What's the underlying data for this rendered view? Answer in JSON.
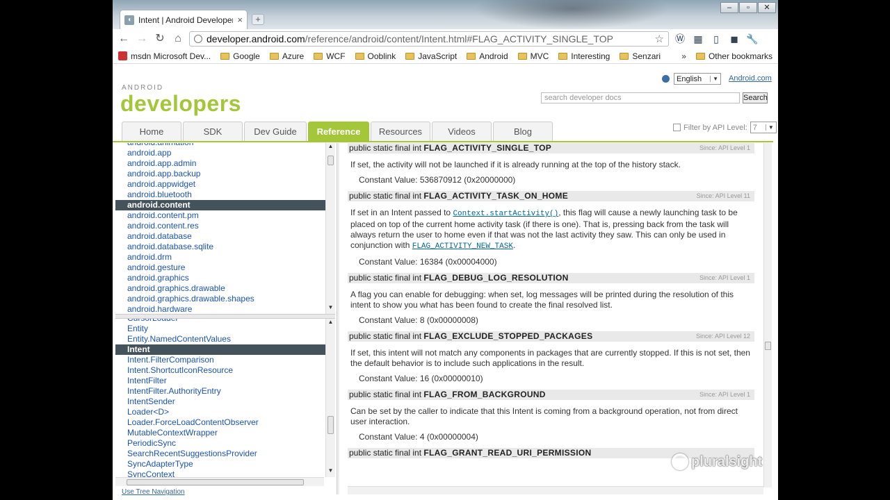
{
  "browser": {
    "tab_title": "Intent | Android Developers",
    "url_host": "developer.android.com",
    "url_path": "/reference/android/content/Intent.html#FLAG_ACTIVITY_SINGLE_TOP",
    "bookmarks": [
      {
        "label": "msdn Microsoft Dev...",
        "icon": "msdn-icon"
      },
      {
        "label": "Google",
        "icon": "folder-icon"
      },
      {
        "label": "Azure",
        "icon": "folder-icon"
      },
      {
        "label": "WCF",
        "icon": "folder-icon"
      },
      {
        "label": "Ooblink",
        "icon": "folder-icon"
      },
      {
        "label": "JavaScript",
        "icon": "folder-icon"
      },
      {
        "label": "Android",
        "icon": "folder-icon"
      },
      {
        "label": "MVC",
        "icon": "folder-icon"
      },
      {
        "label": "Interesting",
        "icon": "folder-icon"
      },
      {
        "label": "Senzari",
        "icon": "folder-icon"
      }
    ],
    "more_bookmarks": "»",
    "other_bookmarks": "Other bookmarks"
  },
  "site": {
    "logo_small": "ANDROID",
    "logo": "developers",
    "language": "English",
    "android_com": "Android.com",
    "search_placeholder": "search developer docs",
    "search_button": "Search",
    "tabs": [
      "Home",
      "SDK",
      "Dev Guide",
      "Reference",
      "Resources",
      "Videos",
      "Blog"
    ],
    "active_tab": "Reference",
    "filter_label": "Filter by API Level:",
    "filter_value": "7",
    "tree_nav": "Use Tree Navigation",
    "brand_color": "#a4c639"
  },
  "packages": [
    "android.animation",
    "android.app",
    "android.app.admin",
    "android.app.backup",
    "android.appwidget",
    "android.bluetooth",
    "android.content",
    "android.content.pm",
    "android.content.res",
    "android.database",
    "android.database.sqlite",
    "android.drm",
    "android.gesture",
    "android.graphics",
    "android.graphics.drawable",
    "android.graphics.drawable.shapes",
    "android.hardware"
  ],
  "selected_package": "android.content",
  "classes": [
    "CursorLoader",
    "Entity",
    "Entity.NamedContentValues",
    "Intent",
    "Intent.FilterComparison",
    "Intent.ShortcutIconResource",
    "IntentFilter",
    "IntentFilter.AuthorityEntry",
    "IntentSender",
    "Loader<D>",
    "Loader.ForceLoadContentObserver",
    "MutableContextWrapper",
    "PeriodicSync",
    "SearchRecentSuggestionsProvider",
    "SyncAdapterType",
    "SyncContext"
  ],
  "selected_class": "Intent",
  "members": [
    {
      "prefix": "public static final int",
      "name": "FLAG_ACTIVITY_SINGLE_TOP",
      "since": "Since: API Level 1",
      "desc_parts": [
        {
          "t": "If set, the activity will not be launched if it is already running at the top of the history stack."
        }
      ],
      "constant": "Constant Value: 536870912 (0x20000000)"
    },
    {
      "prefix": "public static final int",
      "name": "FLAG_ACTIVITY_TASK_ON_HOME",
      "since": "Since: API Level 11",
      "desc_parts": [
        {
          "t": "If set in an Intent passed to "
        },
        {
          "code": "Context.startActivity()"
        },
        {
          "t": ", this flag will cause a newly launching task to be placed on top of the current home activity task (if there is one). That is, pressing back from the task will always return the user to home even if that was not the last activity they saw. This can only be used in conjunction with "
        },
        {
          "code": "FLAG_ACTIVITY_NEW_TASK"
        },
        {
          "t": "."
        }
      ],
      "constant": "Constant Value: 16384 (0x00004000)"
    },
    {
      "prefix": "public static final int",
      "name": "FLAG_DEBUG_LOG_RESOLUTION",
      "since": "Since: API Level 1",
      "desc_parts": [
        {
          "t": "A flag you can enable for debugging: when set, log messages will be printed during the resolution of this intent to show you what has been found to create the final resolved list."
        }
      ],
      "constant": "Constant Value: 8 (0x00000008)"
    },
    {
      "prefix": "public static final int",
      "name": "FLAG_EXCLUDE_STOPPED_PACKAGES",
      "since": "Since: API Level 12",
      "desc_parts": [
        {
          "t": "If set, this intent will not match any components in packages that are currently stopped. If this is not set, then the default behavior is to include such applications in the result."
        }
      ],
      "constant": "Constant Value: 16 (0x00000010)"
    },
    {
      "prefix": "public static final int",
      "name": "FLAG_FROM_BACKGROUND",
      "since": "Since: API Level 1",
      "desc_parts": [
        {
          "t": "Can be set by the caller to indicate that this Intent is coming from a background operation, not from direct user interaction."
        }
      ],
      "constant": "Constant Value: 4 (0x00000004)"
    },
    {
      "prefix": "public static final int",
      "name": "FLAG_GRANT_READ_URI_PERMISSION",
      "since": "",
      "desc_parts": [],
      "constant": ""
    }
  ],
  "watermark": "pluralsight"
}
